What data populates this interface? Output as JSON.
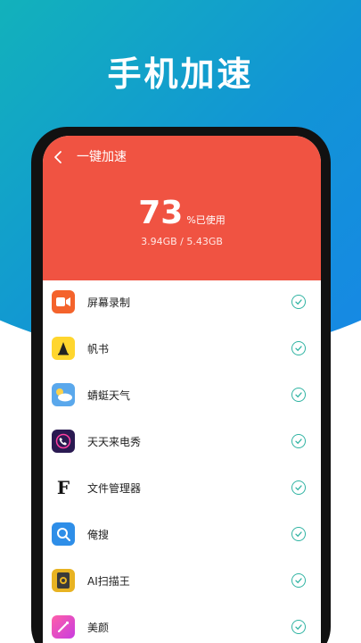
{
  "headline": "手机加速",
  "header": {
    "title": "一键加速"
  },
  "usage": {
    "percent": "73",
    "unit": "%已使用",
    "detail": "3.94GB / 5.43GB"
  },
  "colors": {
    "accent": "#f05342",
    "check": "#2fb3a2"
  },
  "apps": [
    {
      "name": "屏幕录制",
      "icon": "video-icon"
    },
    {
      "name": "帆书",
      "icon": "fanshu-icon"
    },
    {
      "name": "蜻蜓天气",
      "icon": "weather-icon"
    },
    {
      "name": "天天来电秀",
      "icon": "phone-icon"
    },
    {
      "name": "文件管理器",
      "icon": "file-manager-icon"
    },
    {
      "name": "俺搜",
      "icon": "search-app-icon"
    },
    {
      "name": "AI扫描王",
      "icon": "scanner-icon"
    },
    {
      "name": "美颜",
      "icon": "beauty-icon"
    }
  ]
}
